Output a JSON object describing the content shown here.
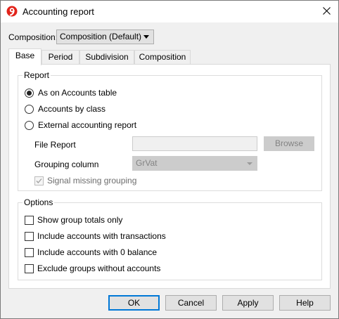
{
  "window": {
    "title": "Accounting report",
    "app_icon": "banana-accounting-icon",
    "close_icon": "close-icon"
  },
  "composition": {
    "label": "Composition:",
    "selected": "Composition (Default)"
  },
  "tabs": [
    {
      "label": "Base",
      "active": true
    },
    {
      "label": "Period",
      "active": false
    },
    {
      "label": "Subdivision",
      "active": false
    },
    {
      "label": "Composition",
      "active": false
    }
  ],
  "report": {
    "title": "Report",
    "options": [
      {
        "label": "As on Accounts table",
        "checked": true
      },
      {
        "label": "Accounts by class",
        "checked": false
      },
      {
        "label": "External accounting report",
        "checked": false
      }
    ],
    "file_report_label": "File Report",
    "file_report_value": "",
    "browse_label": "Browse",
    "grouping_label": "Grouping column",
    "grouping_value": "GrVat",
    "signal_missing_label": "Signal missing grouping",
    "signal_missing_checked": true
  },
  "options": {
    "title": "Options",
    "items": [
      {
        "label": "Show group totals only",
        "checked": false
      },
      {
        "label": "Include accounts with transactions",
        "checked": false
      },
      {
        "label": "Include accounts with 0 balance",
        "checked": false
      },
      {
        "label": "Exclude groups without accounts",
        "checked": false
      }
    ]
  },
  "buttons": {
    "ok": "OK",
    "cancel": "Cancel",
    "apply": "Apply",
    "help": "Help"
  },
  "colors": {
    "default_button_border": "#0078d7",
    "app_icon_red": "#e2231a"
  }
}
